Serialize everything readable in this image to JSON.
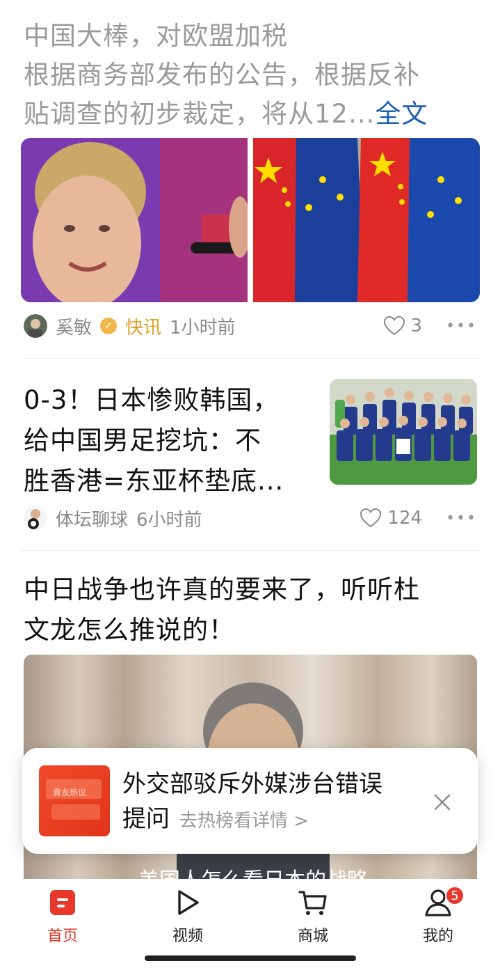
{
  "posts": [
    {
      "title": "中国大棒，对欧盟加税",
      "excerpt_line1": "根据商务部发布的公告，根据反补",
      "excerpt_line2": "贴调查的初步裁定，将从12...",
      "full_text_link": "全文",
      "author": "奚敏",
      "tag": "快讯",
      "time": "1小时前",
      "likes": "3"
    },
    {
      "title_line1": "0-3！日本惨败韩国，",
      "title_line2": "给中国男足挖坑：不",
      "title_line3": "胜香港=东亚杯垫底...",
      "author": "体坛聊球",
      "time": "6小时前",
      "likes": "124"
    },
    {
      "title_line1": "中日战争也许真的要来了，听听杜",
      "title_line2": "文龙怎么推说的！",
      "video_subtitle": "美国人怎么看日本的战略"
    }
  ],
  "notification": {
    "thumb_label": "青友热议",
    "title": "外交部驳斥外媒涉台错误",
    "title_line2": "提问",
    "link": "去热榜看详情 >"
  },
  "nav": {
    "items": [
      {
        "label": "首页",
        "icon": "home-icon",
        "active": true
      },
      {
        "label": "视频",
        "icon": "play-icon"
      },
      {
        "label": "商城",
        "icon": "cart-icon"
      },
      {
        "label": "我的",
        "icon": "profile-icon"
      }
    ],
    "badge": "5"
  },
  "colors": {
    "accent": "#e8382c",
    "link": "#1d5fb3",
    "tag": "#e0a020",
    "muted": "#9a9a9a"
  }
}
